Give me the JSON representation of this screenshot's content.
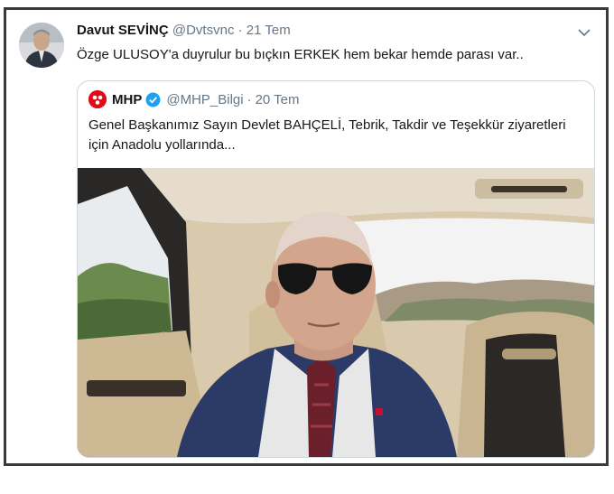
{
  "tweet": {
    "author_name": "Davut SEVİNÇ",
    "author_handle": "@Dvtsvnc",
    "separator": "·",
    "date": "21 Tem",
    "text": "Özge ULUSOY'a duyrulur bu bıçkın ERKEK hem bekar hemde parası var.."
  },
  "quoted_tweet": {
    "author_name": "MHP",
    "author_handle": "@MHP_Bilgi",
    "separator": "·",
    "date": "20 Tem",
    "text": "Genel Başkanımız Sayın Devlet BAHÇELİ, Tebrik, Takdir ve Teşekkür ziyaretleri için Anadolu yollarında..."
  },
  "icons": {
    "more": "chevron-down-icon",
    "verified": "verified-badge-icon",
    "logo": "mhp-logo-icon"
  },
  "colors": {
    "text_primary": "#14171a",
    "text_secondary": "#657786",
    "border": "#ccd6dd",
    "verified_blue": "#1da1f2",
    "mhp_red": "#e30a17"
  }
}
